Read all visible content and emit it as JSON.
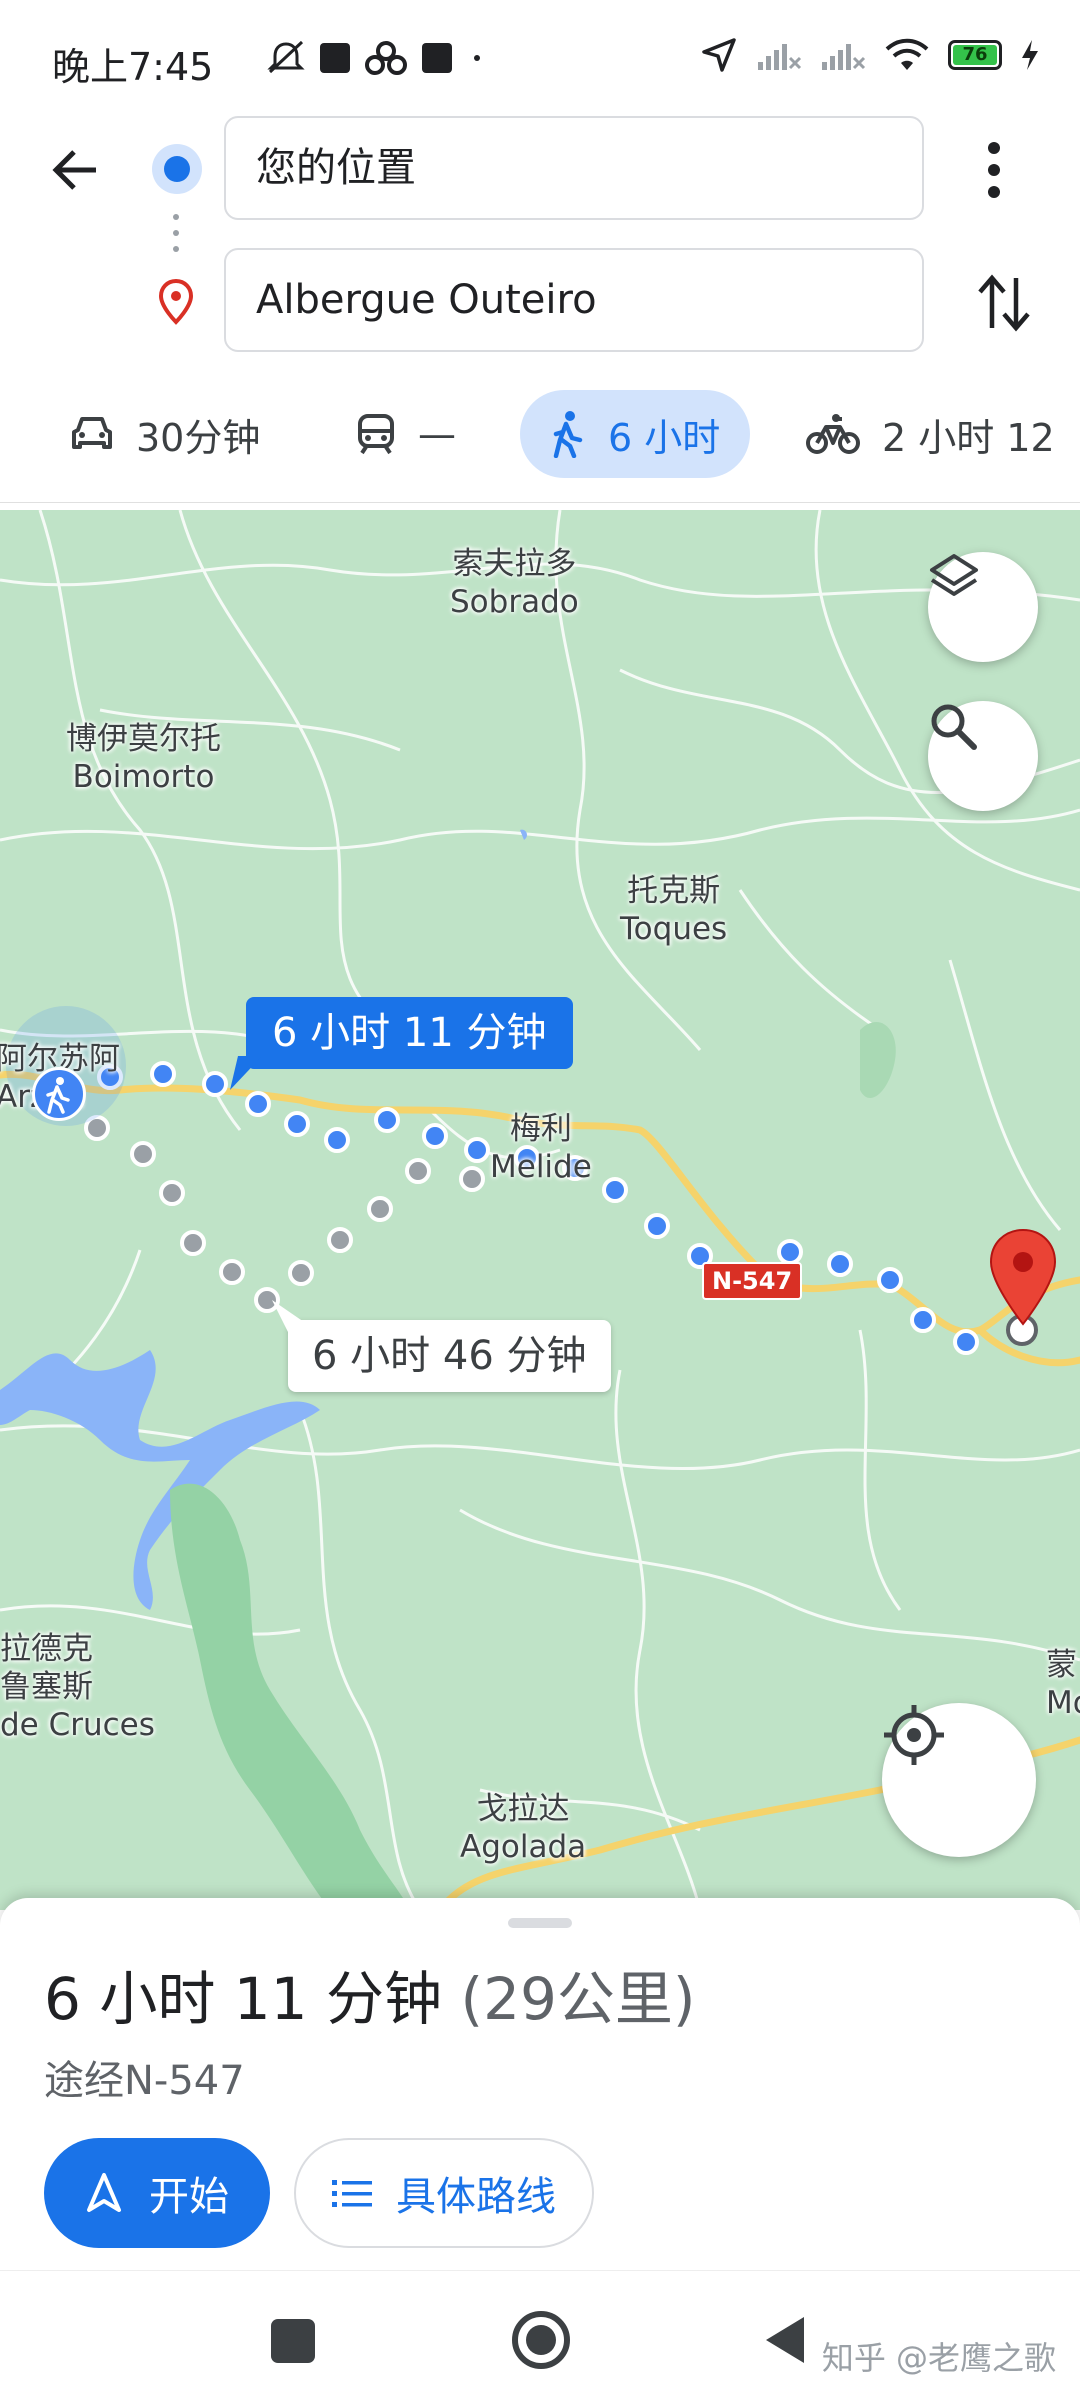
{
  "status_bar": {
    "time": "晚上7:45",
    "battery_level": "76",
    "icons_left": [
      "mute-icon",
      "notification-square-icon",
      "app-cluster-icon",
      "notification-square-icon",
      "dot-icon"
    ],
    "icons_right": [
      "location-arrow-icon",
      "signal-off-icon",
      "signal-off-icon",
      "wifi-icon",
      "battery-icon",
      "charging-icon"
    ]
  },
  "directions": {
    "origin_value": "您的位置",
    "destination_value": "Albergue Outeiro"
  },
  "modes": [
    {
      "name": "drive",
      "icon": "car-icon",
      "label": "30分钟",
      "active": false
    },
    {
      "name": "transit",
      "icon": "train-icon",
      "label": "—",
      "active": false
    },
    {
      "name": "walk",
      "icon": "walk-icon",
      "label": "6 小时",
      "active": true
    },
    {
      "name": "bike",
      "icon": "bike-icon",
      "label": "2 小时 12",
      "active": false
    }
  ],
  "map": {
    "places": [
      {
        "zh": "索夫拉多",
        "en": "Sobrado"
      },
      {
        "zh": "博伊莫尔托",
        "en": "Boimorto"
      },
      {
        "zh": "托克斯",
        "en": "Toques"
      },
      {
        "zh": "阿尔苏阿",
        "en": "Arzúa"
      },
      {
        "zh": "梅利",
        "en": "Melide"
      },
      {
        "zh": "拉德克",
        "zh2": "鲁塞斯",
        "en": "de Cruces"
      },
      {
        "zh": "戈拉达",
        "en": "Agolada"
      },
      {
        "zh": "蒙",
        "en": "Mo"
      }
    ],
    "callout_primary": "6 小时 11 分钟",
    "callout_alternate": "6 小时 46 分钟",
    "road_label": "N-547",
    "route_color": "#4285f4",
    "alt_route_color": "#9aa0a6",
    "destination_pin_color": "#ea4335"
  },
  "summary": {
    "duration": "6 小时 11 分钟",
    "distance": "(29公里)",
    "via": "途经N-547",
    "start_label": "开始",
    "steps_label": "具体路线"
  },
  "watermark": "知乎 @老鹰之歌"
}
